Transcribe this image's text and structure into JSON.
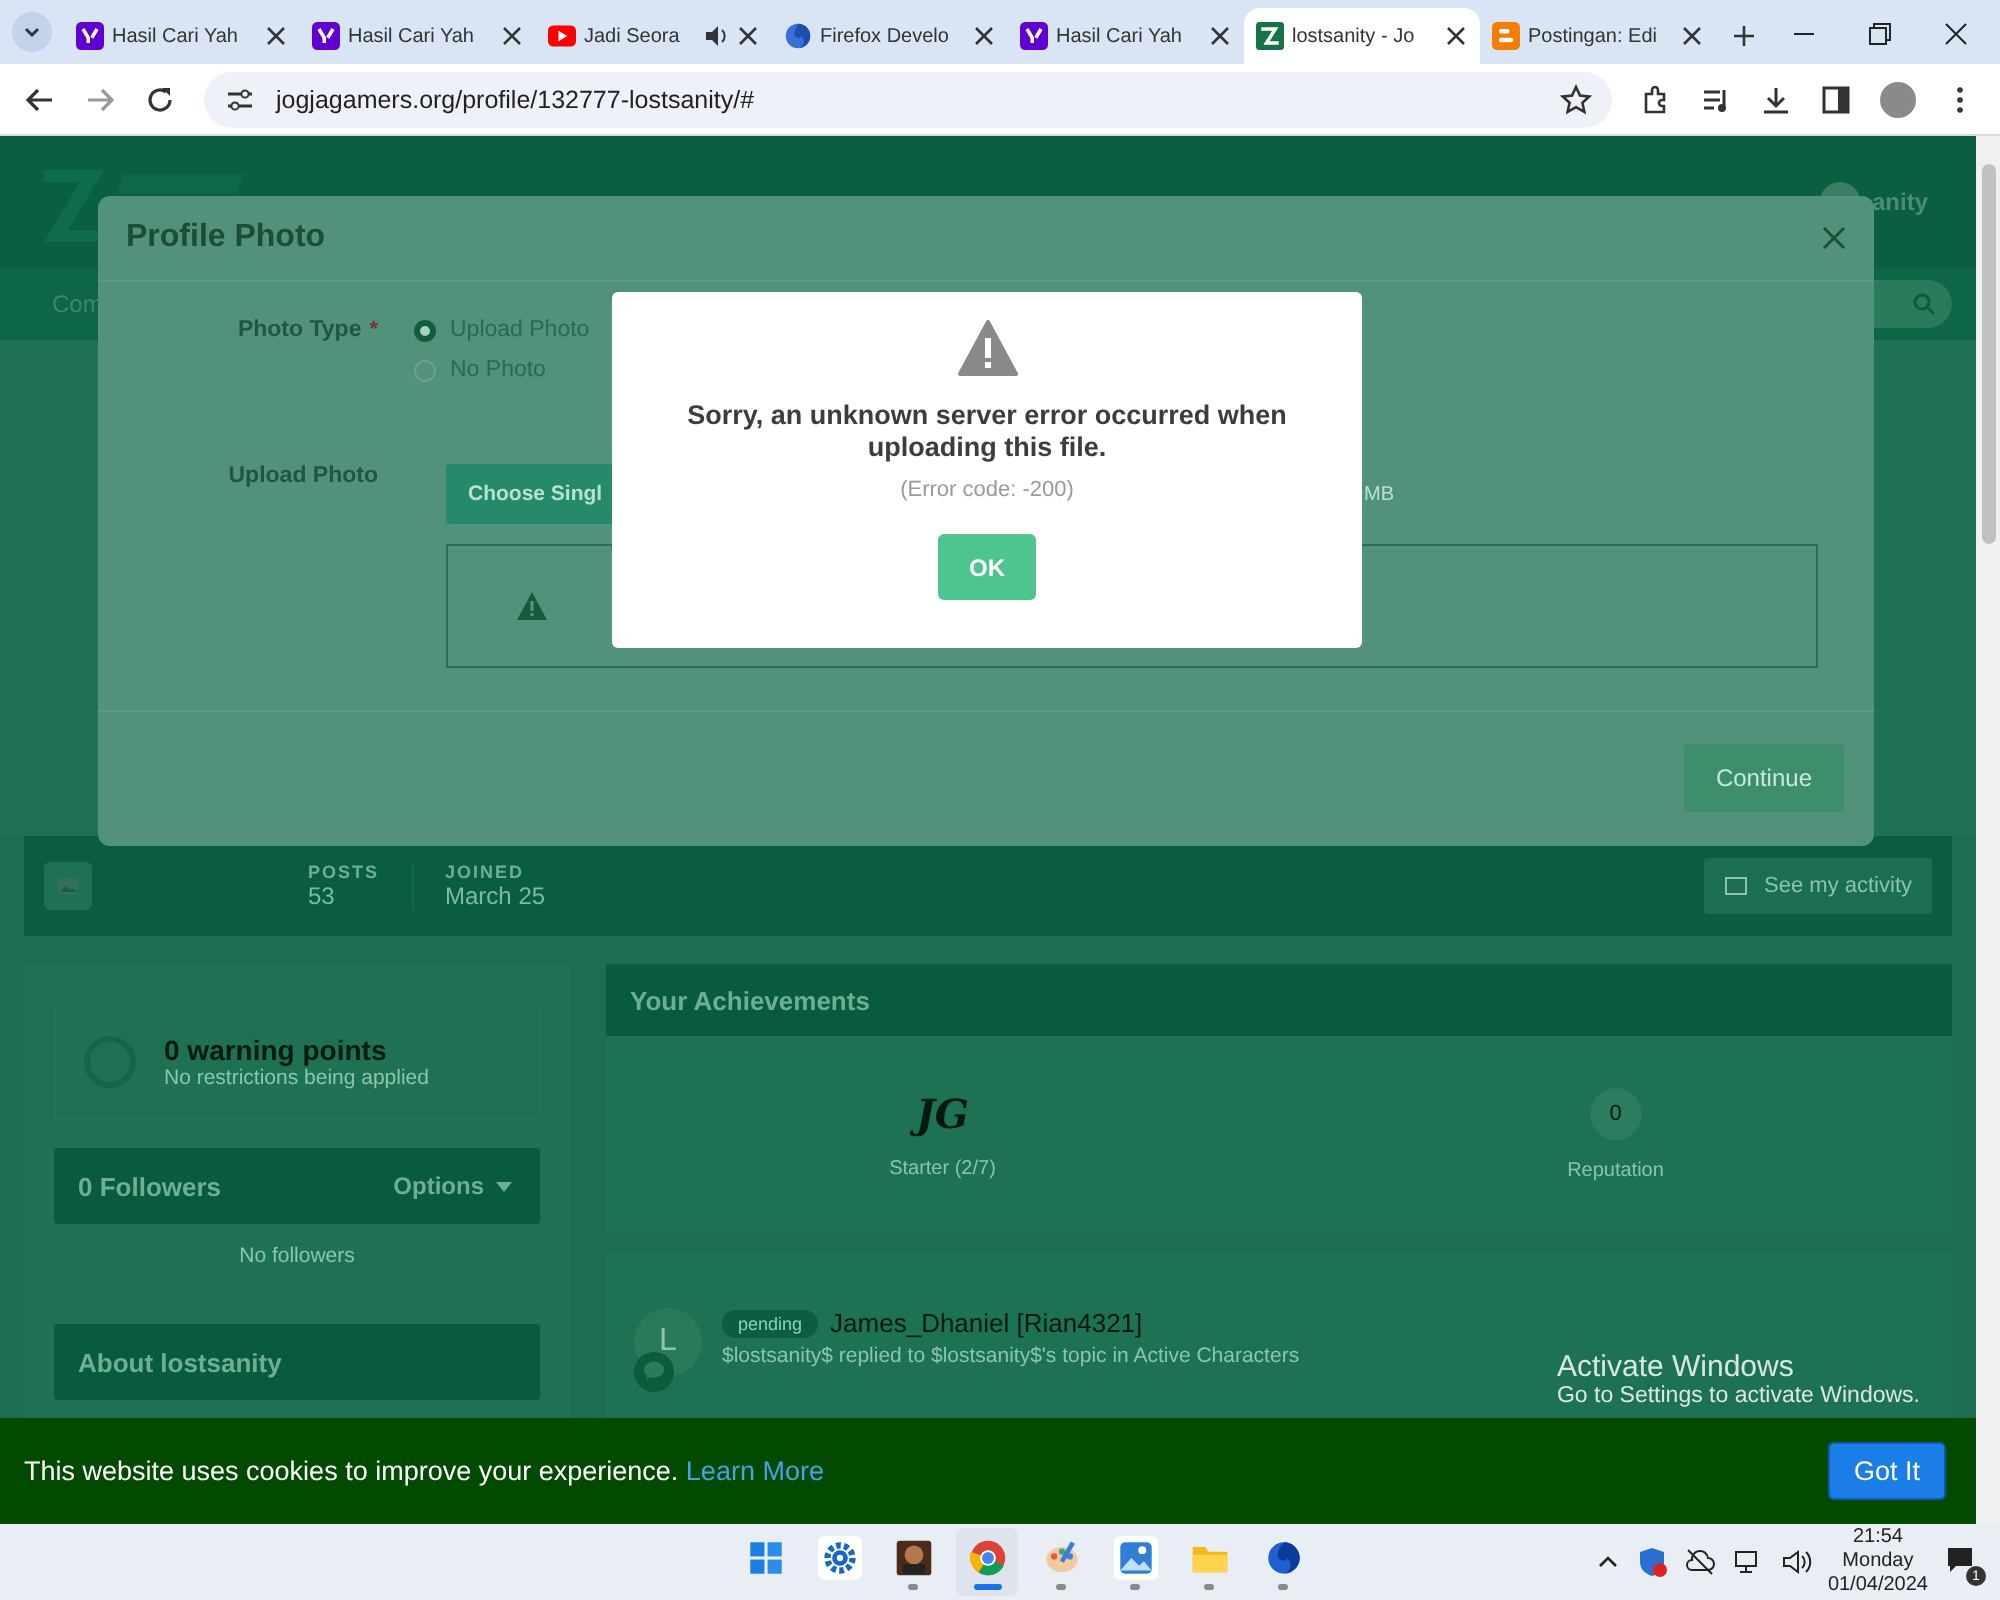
{
  "browser": {
    "tabs": [
      {
        "title": "Hasil Cari Yah",
        "kind": "yahoo",
        "audio": false,
        "selected": false
      },
      {
        "title": "Hasil Cari Yah",
        "kind": "yahoo",
        "audio": false,
        "selected": false
      },
      {
        "title": "Jadi Seora",
        "kind": "youtube",
        "audio": true,
        "selected": false
      },
      {
        "title": "Firefox Develo",
        "kind": "firefox",
        "audio": false,
        "selected": false
      },
      {
        "title": "Hasil Cari Yah",
        "kind": "yahoo",
        "audio": false,
        "selected": false
      },
      {
        "title": "lostsanity - Jo",
        "kind": "site",
        "audio": false,
        "selected": true
      },
      {
        "title": "Postingan: Edi",
        "kind": "blogger",
        "audio": false,
        "selected": false
      }
    ],
    "url": "jogjagamers.org/profile/132777-lostsanity/#"
  },
  "site_header": {
    "nav_text": "Com",
    "user_name": "anity"
  },
  "profile": {
    "stats": [
      {
        "label": "POSTS",
        "value": "53"
      },
      {
        "label": "JOINED",
        "value": "March 25"
      }
    ],
    "activity_button": "See my activity"
  },
  "warning": {
    "title": "0 warning points",
    "subtitle": "No restrictions being applied"
  },
  "followers": {
    "title": "0 Followers",
    "options": "Options",
    "empty": "No followers"
  },
  "about": {
    "title": "About lostsanity"
  },
  "achievements": {
    "title": "Your Achievements",
    "items": [
      {
        "kind": "rank",
        "badge": "JG",
        "label": "Starter (2/7)"
      },
      {
        "kind": "reputation",
        "badge": "0",
        "label": "Reputation"
      }
    ]
  },
  "activity": [
    {
      "avatar": "L",
      "status": "pending",
      "author": "James_Dhaniel [Rian4321]",
      "text": "$lostsanity$ replied to $lostsanity$'s topic in Active Characters"
    }
  ],
  "profile_photo_modal": {
    "title": "Profile Photo",
    "photo_type_label": "Photo Type",
    "required_mark": "*",
    "options": [
      {
        "label": "Upload Photo",
        "selected": true
      },
      {
        "label": "No Photo",
        "selected": false
      }
    ],
    "upload_label": "Upload Photo",
    "choose_button": "Choose Singl",
    "size_hint": "MB",
    "continue_button": "Continue"
  },
  "alert": {
    "message": "Sorry, an unknown server error occurred when uploading this file.",
    "error_code": "(Error code: -200)",
    "ok_button": "OK"
  },
  "cookie_bar": {
    "message": "This website uses cookies to improve your experience.",
    "link": "Learn More",
    "button": "Got It"
  },
  "os_notice": {
    "title": "Activate Windows",
    "subtitle": "Go to Settings to activate Windows."
  },
  "taskbar": {
    "apps": [
      {
        "kind": "start",
        "running": false,
        "focused": false
      },
      {
        "kind": "settings",
        "running": false,
        "focused": false
      },
      {
        "kind": "game",
        "running": true,
        "focused": false
      },
      {
        "kind": "chrome",
        "running": true,
        "focused": true
      },
      {
        "kind": "paint",
        "running": true,
        "focused": false
      },
      {
        "kind": "photos",
        "running": true,
        "focused": false
      },
      {
        "kind": "files",
        "running": true,
        "focused": false
      },
      {
        "kind": "firefox",
        "running": true,
        "focused": false
      }
    ],
    "time": "21:54",
    "day": "Monday",
    "date": "01/04/2024",
    "notification_count": "1"
  }
}
